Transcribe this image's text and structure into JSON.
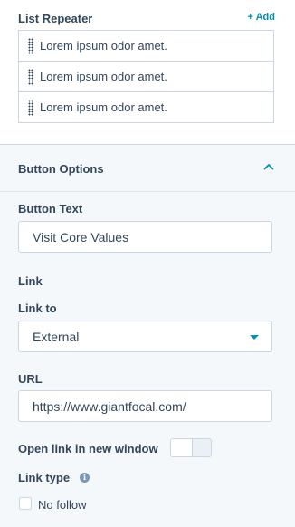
{
  "list_repeater": {
    "title": "List Repeater",
    "add_label": "+ Add",
    "items": [
      {
        "label": "Lorem ipsum odor amet."
      },
      {
        "label": "Lorem ipsum odor amet."
      },
      {
        "label": "Lorem ipsum odor amet."
      }
    ]
  },
  "button_options": {
    "title": "Button Options",
    "expanded": true,
    "button_text": {
      "label": "Button Text",
      "value": "Visit Core Values"
    },
    "link_section": "Link",
    "link_to": {
      "label": "Link to",
      "value": "External"
    },
    "url": {
      "label": "URL",
      "value": "https://www.giantfocal.com/"
    },
    "new_window": {
      "label": "Open link in new window",
      "enabled": false
    },
    "link_type": {
      "label": "Link type",
      "info_icon": "info-icon"
    },
    "no_follow": {
      "label": "No follow",
      "checked": false
    }
  },
  "colors": {
    "accent": "#0091ae",
    "text": "#33475b",
    "border": "#cbd6e2",
    "panel": "#f5f8fa"
  }
}
